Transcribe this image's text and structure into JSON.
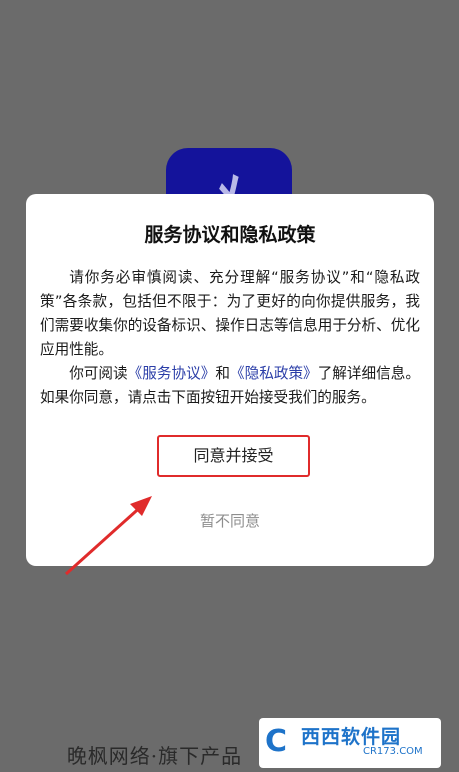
{
  "logo": {
    "icon": "app-logo-icon",
    "color": "#14139b"
  },
  "dialog": {
    "title": "服务协议和隐私政策",
    "p1": "请你务必审慎阅读、充分理解“服务协议”和“隐私政策”各条款，包括但不限于：为了更好的向你提供服务，我们需要收集你的设备标识、操作日志等信息用于分析、优化应用性能。",
    "p2_prefix": "你可阅读",
    "link_service": "《服务协议》",
    "p2_and": "和",
    "link_privacy": "《隐私政策》",
    "p2_suffix": "了解详细信息。如果你同意，请点击下面按钮开始接受我们的服务。",
    "agree_label": "同意并接受",
    "disagree_label": "暂不同意"
  },
  "footer": {
    "brand": "晚枫网络·旗下产品"
  },
  "watermark": {
    "name": "西西软件园",
    "url": "CR173.COM"
  },
  "colors": {
    "link": "#2b3ea8",
    "highlight": "#e02b2b",
    "overlay": "#6b6b6b"
  }
}
